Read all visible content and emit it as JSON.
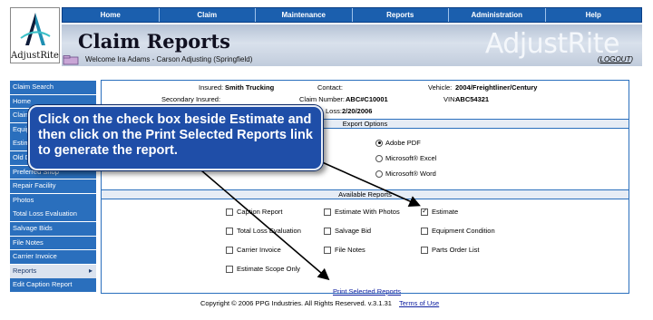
{
  "logo": {
    "text": "AdjustRite"
  },
  "nav": [
    "Home",
    "Claim",
    "Maintenance",
    "Reports",
    "Administration",
    "Help"
  ],
  "header": {
    "title": "Claim Reports",
    "brand": "AdjustRite",
    "welcome": "Welcome Ira Adams - Carson Adjusting (Springfield)",
    "logout": "LOGOUT"
  },
  "sidebar": {
    "items": [
      {
        "label": "Claim Search"
      },
      {
        "label": "Home"
      },
      {
        "label": "Claim"
      },
      {
        "label": "Equip"
      },
      {
        "label": "Estim"
      },
      {
        "label": "Old D"
      },
      {
        "label": "Preferred Shop"
      },
      {
        "label": "Repair Facility"
      },
      {
        "label": "Photos"
      },
      {
        "label": "Total Loss Evaluation"
      },
      {
        "label": "Salvage Bids"
      },
      {
        "label": "File Notes"
      },
      {
        "label": "Carrier Invoice"
      },
      {
        "label": "Reports"
      },
      {
        "label": "Edit Caption Report"
      }
    ]
  },
  "claim_info": {
    "insured_label": "Insured:",
    "insured": "Smith Trucking",
    "contact_label": "Contact:",
    "vehicle_label": "Vehicle:",
    "vehicle": "2004/Freightliner/Century",
    "secondary_label": "Secondary Insured:",
    "claim_number_label": "Claim Number:",
    "claim_number": "ABC#C10001",
    "vin_label": "VIN:",
    "vin": "ABC54321",
    "loss_label": "Loss:",
    "loss_date": "2/20/2006"
  },
  "export": {
    "title": "Export Options",
    "options": [
      "Adobe PDF",
      "Microsoft® Excel",
      "Microsoft® Word"
    ],
    "selected": "Adobe PDF",
    "partial_label": "on"
  },
  "reports": {
    "title": "Available Reports",
    "items": [
      {
        "label": "Caption Report",
        "checked": false
      },
      {
        "label": "Estimate With Photos",
        "checked": false
      },
      {
        "label": "Estimate",
        "checked": true
      },
      {
        "label": "Total Loss Evaluation",
        "checked": false
      },
      {
        "label": "Salvage Bid",
        "checked": false
      },
      {
        "label": "Equipment Condition",
        "checked": false
      },
      {
        "label": "Carrier Invoice",
        "checked": false
      },
      {
        "label": "File Notes",
        "checked": false
      },
      {
        "label": "Parts Order List",
        "checked": false
      },
      {
        "label": "Estimate Scope Only",
        "checked": false
      }
    ],
    "print_link": "Print Selected Reports"
  },
  "footer": {
    "copyright": "Copyright © 2006 PPG Industries. All Rights Reserved. v.3.1.31",
    "terms": "Terms of Use"
  },
  "callout": {
    "text": "Click on the check box beside Estimate and then click on the Print Selected Reports link to generate the report."
  },
  "colors": {
    "nav": "#1b5fae",
    "callout": "#1f4ea8",
    "sidebar": "#2a6fbd"
  }
}
